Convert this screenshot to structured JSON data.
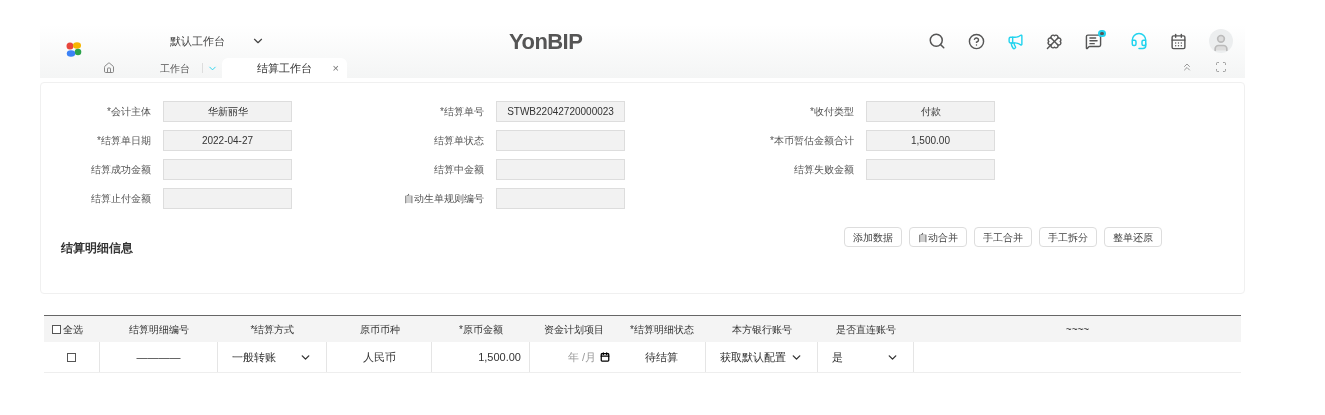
{
  "header": {
    "workspace": "默认工作台",
    "brand": "YonBIP",
    "message_badge": true
  },
  "tabs": [
    {
      "label": "工作台",
      "selected": false,
      "closable": false
    },
    {
      "label": "结算工作台",
      "selected": true,
      "closable": true
    }
  ],
  "tab_close": "×",
  "form": {
    "rows": [
      [
        {
          "label": "*会计主体",
          "value": "华新丽华"
        },
        {
          "label": "*结算单号",
          "value": "STWB22042720000023"
        },
        {
          "label": "*收付类型",
          "value": "付款"
        }
      ],
      [
        {
          "label": "*结算单日期",
          "value": "2022-04-27"
        },
        {
          "label": "结算单状态"
        },
        {
          "label": "*本币暂估金额合计",
          "value": "1,500.00"
        }
      ],
      [
        {
          "label": "结算成功金额"
        },
        {
          "label": "结算中金额"
        },
        {
          "label": "结算失败金额"
        }
      ],
      [
        {
          "label": "结算止付金额"
        },
        {
          "label": "自动生单规则编号"
        }
      ]
    ],
    "section_title": "结算明细信息",
    "buttons": [
      "添加数据",
      "自动合并",
      "手工合并",
      "手工拆分",
      "整单还原"
    ]
  },
  "table": {
    "select_all": {
      "label": "全选",
      "checked": false
    },
    "columns": [
      "结算明细编号",
      "*结算方式",
      "原币币种",
      "*原币金额",
      "资金计划项目",
      "*结算明细状态",
      "本方银行账号",
      "是否直连账号",
      "~~~~"
    ],
    "rows": [
      {
        "checked": false,
        "cells": [
          {
            "kind": "text",
            "value": "————"
          },
          {
            "kind": "select",
            "value": "一般转账"
          },
          {
            "kind": "text",
            "value": "人民币"
          },
          {
            "kind": "amount",
            "value": "1,500.00"
          },
          {
            "kind": "date",
            "placeholder": "年 /月"
          },
          {
            "kind": "text",
            "value": "待结算"
          },
          {
            "kind": "select",
            "value": "获取默认配置"
          },
          {
            "kind": "select",
            "value": "是"
          },
          {
            "kind": "empty"
          }
        ]
      }
    ]
  }
}
